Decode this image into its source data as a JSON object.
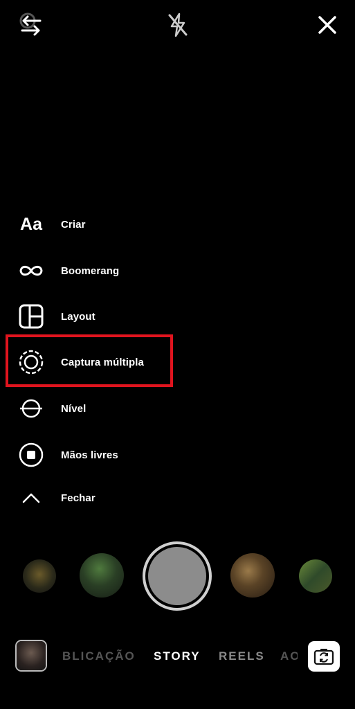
{
  "top_bar": {
    "settings_icon": "gear-icon",
    "switch_icon": "arrows-left-right-icon",
    "flash_icon": "flash-off-icon",
    "close_icon": "close-icon"
  },
  "menu": {
    "items": [
      {
        "label": "Criar",
        "icon": "text-aa-icon"
      },
      {
        "label": "Boomerang",
        "icon": "infinity-icon"
      },
      {
        "label": "Layout",
        "icon": "layout-grid-icon"
      },
      {
        "label": "Captura múltipla",
        "icon": "multi-capture-icon"
      },
      {
        "label": "Nível",
        "icon": "level-icon"
      },
      {
        "label": "Mãos livres",
        "icon": "hands-free-icon"
      },
      {
        "label": "Fechar",
        "icon": "chevron-up-icon"
      }
    ],
    "text_icon_label": "Aa"
  },
  "highlight_color": "#e0141e",
  "mode_bar": {
    "modes": [
      "BLICAÇÃO",
      "STORY",
      "REELS",
      "AO"
    ],
    "active": "STORY"
  }
}
